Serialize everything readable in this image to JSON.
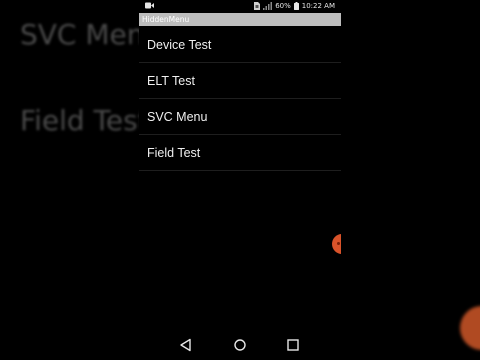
{
  "background": {
    "ghost_text_1": "SVC Menu",
    "ghost_text_2": "Field Test"
  },
  "status_bar": {
    "battery_percent": "60%",
    "time": "10:22 AM",
    "icons": [
      "video-record-icon",
      "sim-icon",
      "signal-icon",
      "battery-icon"
    ]
  },
  "app": {
    "title": "HiddenMenu"
  },
  "menu": {
    "items": [
      {
        "label": "Device Test"
      },
      {
        "label": "ELT Test"
      },
      {
        "label": "SVC Menu"
      },
      {
        "label": "Field Test"
      }
    ]
  },
  "nav_bar": {
    "icons": [
      "back-icon",
      "home-icon",
      "recents-icon"
    ]
  },
  "colors": {
    "title_bar": "#bdbdbd",
    "background": "#000000",
    "accent_fab": "#d9532a"
  }
}
